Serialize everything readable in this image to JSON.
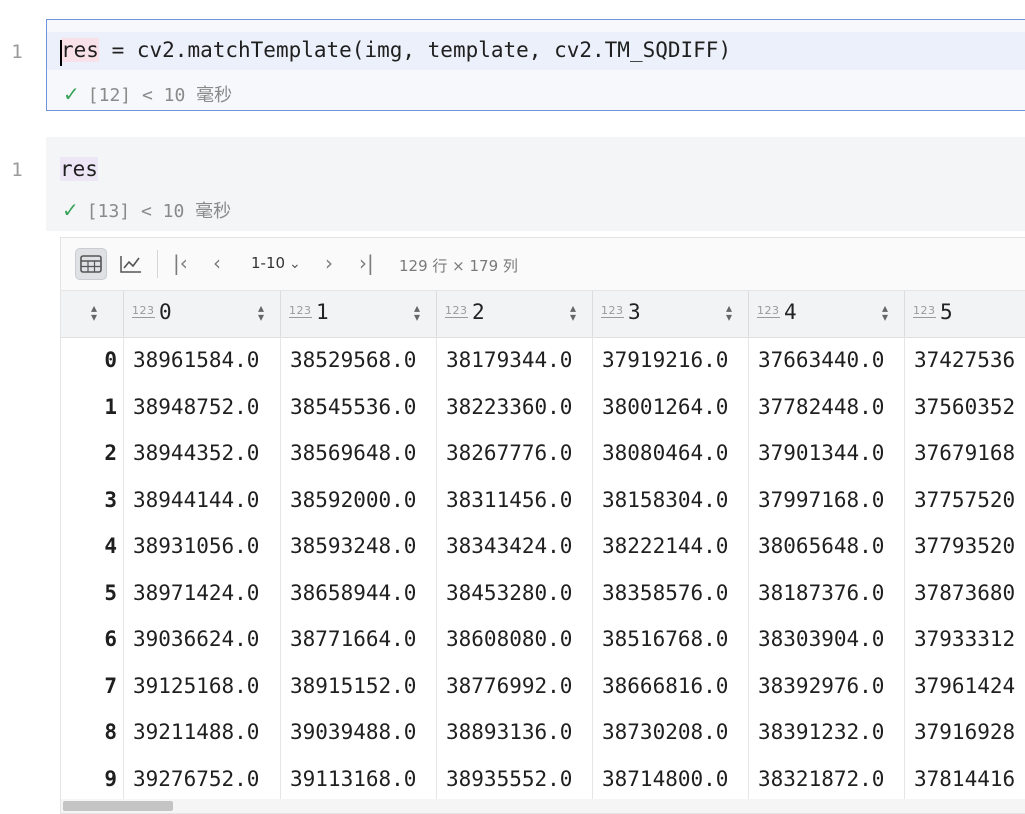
{
  "cells": [
    {
      "line_number": "1",
      "code_var": "res",
      "code_rest": " = cv2.matchTemplate(img, template, cv2.TM_SQDIFF)",
      "status": "[12] < 10 毫秒"
    },
    {
      "line_number": "1",
      "code_var": "res",
      "code_rest": "",
      "status": "[13] < 10 毫秒"
    }
  ],
  "status_check_icon": "check-icon",
  "dataframe": {
    "toolbar": {
      "range_label": "1-10",
      "dims_label": "129 行 × 179 列",
      "icons": [
        "table-view-icon",
        "chart-view-icon",
        "first-page-icon",
        "prev-page-icon",
        "range-dropdown-chevron-icon",
        "next-page-icon",
        "last-page-icon"
      ]
    },
    "dtype_label": "123",
    "columns": [
      "0",
      "1",
      "2",
      "3",
      "4",
      "5"
    ],
    "row_index": [
      "0",
      "1",
      "2",
      "3",
      "4",
      "5",
      "6",
      "7",
      "8",
      "9"
    ],
    "rows": [
      [
        "38961584.0",
        "38529568.0",
        "38179344.0",
        "37919216.0",
        "37663440.0",
        "37427536"
      ],
      [
        "38948752.0",
        "38545536.0",
        "38223360.0",
        "38001264.0",
        "37782448.0",
        "37560352"
      ],
      [
        "38944352.0",
        "38569648.0",
        "38267776.0",
        "38080464.0",
        "37901344.0",
        "37679168"
      ],
      [
        "38944144.0",
        "38592000.0",
        "38311456.0",
        "38158304.0",
        "37997168.0",
        "37757520"
      ],
      [
        "38931056.0",
        "38593248.0",
        "38343424.0",
        "38222144.0",
        "38065648.0",
        "37793520"
      ],
      [
        "38971424.0",
        "38658944.0",
        "38453280.0",
        "38358576.0",
        "38187376.0",
        "37873680"
      ],
      [
        "39036624.0",
        "38771664.0",
        "38608080.0",
        "38516768.0",
        "38303904.0",
        "37933312"
      ],
      [
        "39125168.0",
        "38915152.0",
        "38776992.0",
        "38666816.0",
        "38392976.0",
        "37961424"
      ],
      [
        "39211488.0",
        "39039488.0",
        "38893136.0",
        "38730208.0",
        "38391232.0",
        "37916928"
      ],
      [
        "39276752.0",
        "39113168.0",
        "38935552.0",
        "38714800.0",
        "38321872.0",
        "37814416"
      ]
    ]
  }
}
